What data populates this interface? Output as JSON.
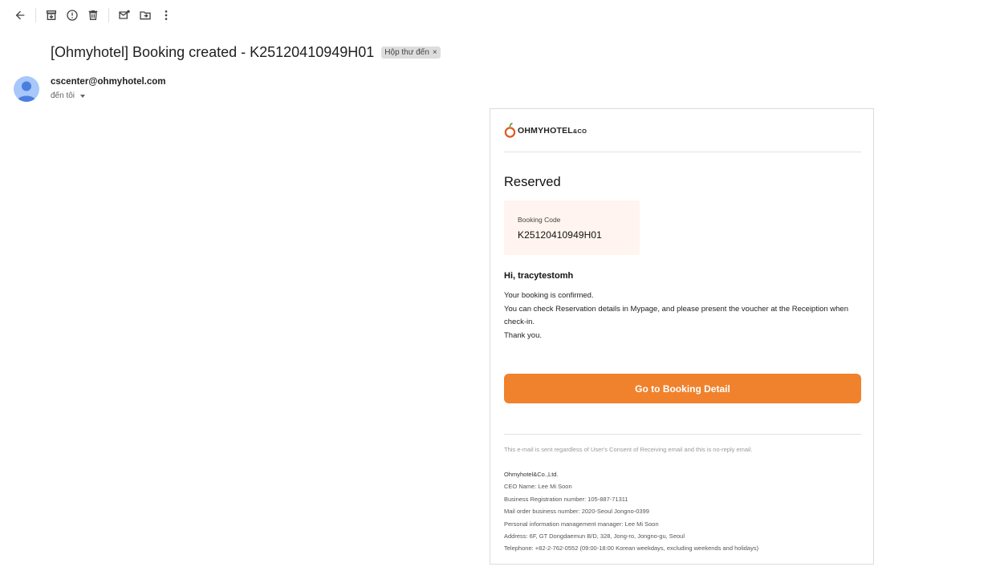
{
  "toolbar": {
    "icons": [
      "back-arrow-icon",
      "archive-icon",
      "report-spam-icon",
      "delete-icon",
      "mark-unread-icon",
      "move-to-icon",
      "more-vert-icon"
    ]
  },
  "email": {
    "subject": "[Ohmyhotel] Booking created - K25120410949H01",
    "label": "Hộp thư đến",
    "label_remove": "×",
    "sender": "cscenter@ohmyhotel.com",
    "to": "đến tôi"
  },
  "message": {
    "logo_text": "OHMYHOTEL",
    "logo_suffix": "&CO",
    "status_title": "Reserved",
    "booking_code_label": "Booking Code",
    "booking_code": "K25120410949H01",
    "greeting": "Hi, tracytestomh",
    "body_lines": [
      "Your booking is confirmed.",
      "You can check Reservation details in Mypage, and please present the voucher at the Receiption when check-in.",
      "Thank you."
    ],
    "cta_label": "Go to Booking Detail",
    "cta_color": "#f0822d",
    "disclaimer": "This e-mail is sent regardless of User's Consent of Receiving email and this is no-reply email.",
    "footer": {
      "company": "Ohmyhotel&Co.,Ltd.",
      "lines": [
        "CEO Name: Lee Mi Soon",
        "Business Registration number: 105-887-71311",
        "Mail order business number: 2020-Seoul Jongno-0399",
        "Personal information management manager: Lee Mi Soon",
        "Address: 6F, GT Dongdaemun B/D, 328, Jong-ro, Jongno-gu, Seoul",
        "Telephone: +82-2-762-0552 (09:00-18:00 Korean weekdays, excluding weekends and holidays)"
      ]
    }
  }
}
